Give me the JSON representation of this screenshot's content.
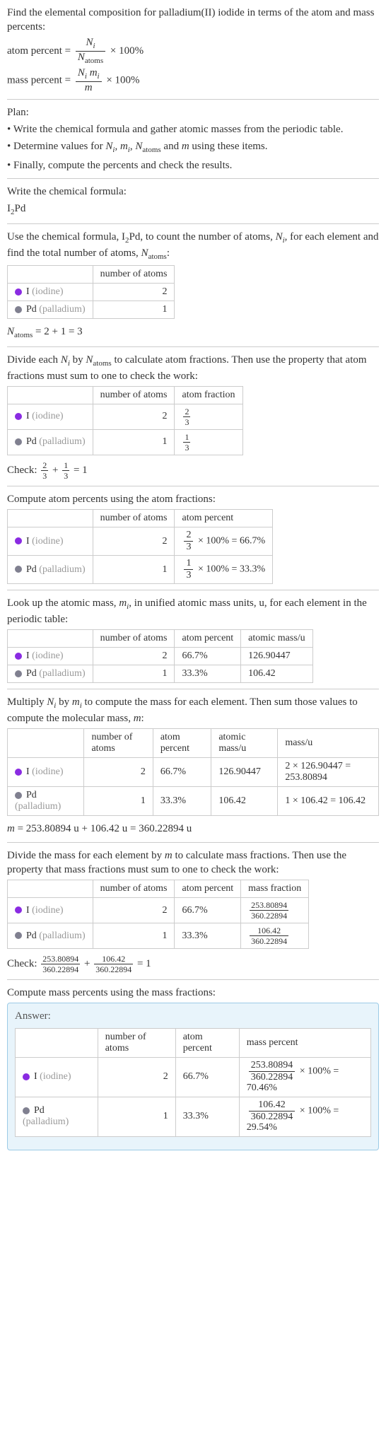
{
  "intro": {
    "line1": "Find the elemental composition for palladium(II) iodide in terms of the atom and mass percents:",
    "atom_percent_label": "atom percent =",
    "atom_percent_times": "× 100%",
    "mass_percent_label": "mass percent =",
    "mass_percent_times": "× 100%",
    "Ni": "N",
    "Natoms": "N",
    "atoms_sub": "atoms",
    "mi": "m",
    "m": "m",
    "i_sub": "i"
  },
  "plan": {
    "header": "Plan:",
    "b1": "• Write the chemical formula and gather atomic masses from the periodic table.",
    "b2_a": "• Determine values for ",
    "b2_b": " using these items.",
    "b2_vars": "N",
    "b3": "• Finally, compute the percents and check the results."
  },
  "formula": {
    "header": "Write the chemical formula:",
    "value": "I",
    "sub2": "2",
    "pd": "Pd"
  },
  "count": {
    "text_a": "Use the chemical formula, I",
    "text_b": "Pd, to count the number of atoms, ",
    "text_c": ", for each element and find the total number of atoms, ",
    "colon": ":",
    "hdr_num": "number of atoms",
    "iodine_label": "I ",
    "iodine_gray": "(iodine)",
    "pd_label": "Pd ",
    "pd_gray": "(palladium)",
    "iodine_n": "2",
    "pd_n": "1",
    "sum_a": "N",
    "sum_b": " = 2 + 1 = 3"
  },
  "atomfrac": {
    "text_a": "Divide each ",
    "text_b": " by ",
    "text_c": " to calculate atom fractions. Then use the property that atom fractions must sum to one to check the work:",
    "hdr_num": "number of atoms",
    "hdr_frac": "atom fraction",
    "i_n": "2",
    "pd_n": "1",
    "i_frac_num": "2",
    "i_frac_den": "3",
    "pd_frac_num": "1",
    "pd_frac_den": "3",
    "check": "Check: ",
    "eq1": " = 1"
  },
  "atompercent": {
    "text": "Compute atom percents using the atom fractions:",
    "hdr_num": "number of atoms",
    "hdr_pct": "atom percent",
    "i_n": "2",
    "pd_n": "1",
    "i_calc": " × 100% = 66.7%",
    "pd_calc": " × 100% = 33.3%"
  },
  "atomicmass": {
    "text_a": "Look up the atomic mass, ",
    "text_b": ", in unified atomic mass units, u, for each element in the periodic table:",
    "hdr_num": "number of atoms",
    "hdr_pct": "atom percent",
    "hdr_mass": "atomic mass/u",
    "i_n": "2",
    "pd_n": "1",
    "i_pct": "66.7%",
    "pd_pct": "33.3%",
    "i_mass": "126.90447",
    "pd_mass": "106.42"
  },
  "molmass": {
    "text_a": "Multiply ",
    "text_b": " by ",
    "text_c": " to compute the mass for each element. Then sum those values to compute the molecular mass, ",
    "text_d": ":",
    "hdr_num": "number of atoms",
    "hdr_pct": "atom percent",
    "hdr_amass": "atomic mass/u",
    "hdr_mass": "mass/u",
    "i_n": "2",
    "pd_n": "1",
    "i_pct": "66.7%",
    "pd_pct": "33.3%",
    "i_amass": "126.90447",
    "pd_amass": "106.42",
    "i_mass": "2 × 126.90447 = 253.80894",
    "pd_mass": "1 × 106.42 = 106.42",
    "sum": " = 253.80894 u + 106.42 u = 360.22894 u"
  },
  "massfrac": {
    "text_a": "Divide the mass for each element by ",
    "text_b": " to calculate mass fractions. Then use the property that mass fractions must sum to one to check the work:",
    "hdr_num": "number of atoms",
    "hdr_pct": "atom percent",
    "hdr_mfrac": "mass fraction",
    "i_n": "2",
    "pd_n": "1",
    "i_pct": "66.7%",
    "pd_pct": "33.3%",
    "i_frac_num": "253.80894",
    "i_frac_den": "360.22894",
    "pd_frac_num": "106.42",
    "pd_frac_den": "360.22894",
    "check": "Check: ",
    "eq1": " = 1"
  },
  "answer": {
    "header": "Compute mass percents using the mass fractions:",
    "label": "Answer:",
    "hdr_num": "number of atoms",
    "hdr_apct": "atom percent",
    "hdr_mpct": "mass percent",
    "i_n": "2",
    "pd_n": "1",
    "i_apct": "66.7%",
    "pd_apct": "33.3%",
    "i_mpct_a": " × 100% = 70.46%",
    "pd_mpct_a": " × 100% = 29.54%",
    "i_num": "253.80894",
    "i_den": "360.22894",
    "pd_num": "106.42",
    "pd_den": "360.22894"
  },
  "labels": {
    "iodine": "I ",
    "iodine_g": "(iodine)",
    "pd": "Pd ",
    "pd_g": "(palladium)"
  }
}
